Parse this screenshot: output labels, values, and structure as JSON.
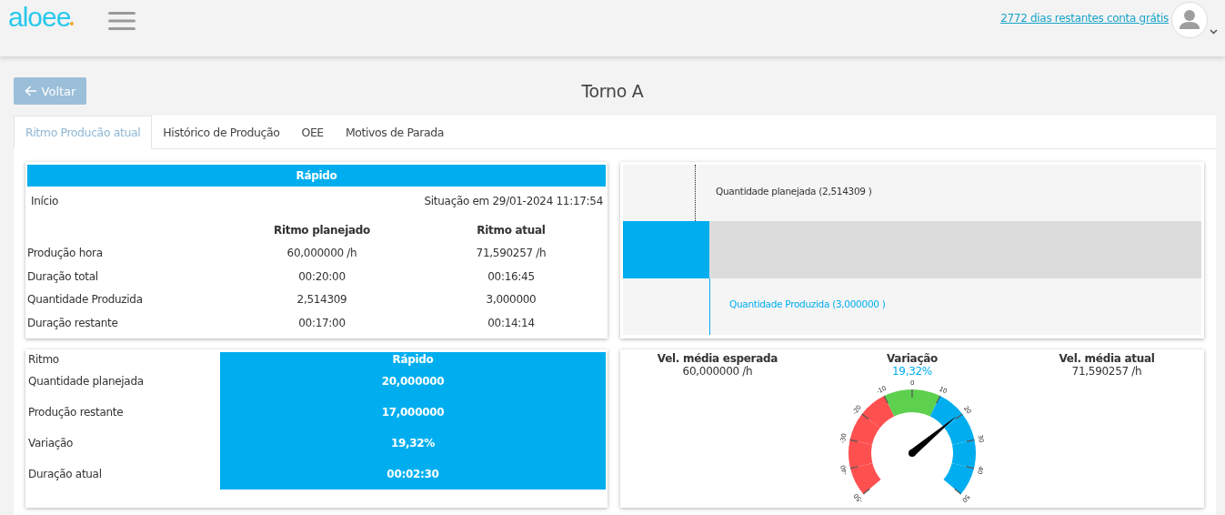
{
  "header": {
    "logo": "aloee",
    "account_link": "2772 dias restantes conta grátis"
  },
  "back_button": "Voltar",
  "page_title": "Torno A",
  "tabs": [
    {
      "label": "Ritmo Producão atual",
      "selected": true
    },
    {
      "label": "Histórico de Produção",
      "selected": false
    },
    {
      "label": "OEE",
      "selected": false
    },
    {
      "label": "Motivos de Parada",
      "selected": false
    }
  ],
  "summary": {
    "status": "Rápido",
    "start_label": "Início",
    "situation": "Situação em 29/01-2024 11:17:54",
    "columns": [
      "Ritmo planejado",
      "Ritmo atual"
    ],
    "rows": [
      {
        "label": "Produção hora",
        "planned": "60,000000 /h",
        "actual": "71,590257 /h"
      },
      {
        "label": "Duração total",
        "planned": "00:20:00",
        "actual": "00:16:45"
      },
      {
        "label": "Quantidade Produzida",
        "planned": "2,514309",
        "actual": "3,000000"
      },
      {
        "label": "Duração restante",
        "planned": "00:17:00",
        "actual": "00:14:14"
      }
    ]
  },
  "progress": {
    "planned": {
      "label": "Quantidade planejada (2,514309 )",
      "level": 0.124
    },
    "produced": {
      "label": "Quantidade Produzida (3,000000 )",
      "level": 0.15
    }
  },
  "rhythm": [
    {
      "kind": "header",
      "label": "Ritmo",
      "value": "Rápido"
    },
    {
      "kind": "row",
      "label": "Quantidade planejada",
      "value": "20,000000"
    },
    {
      "kind": "row",
      "label": "Produção restante",
      "value": "17,000000"
    },
    {
      "kind": "row",
      "label": "Variação",
      "value": "19,32%"
    },
    {
      "kind": "row",
      "label": "Duração atual",
      "value": "00:02:30"
    }
  ],
  "speed": {
    "stats": [
      {
        "label": "Vel. média esperada",
        "value": "60,000000 /h",
        "kind": "plain"
      },
      {
        "label": "Variação",
        "value": "19,32%",
        "kind": "accent"
      },
      {
        "label": "Vel. média atual",
        "value": "71,590257 /h",
        "kind": "plain"
      }
    ],
    "gauge": {
      "ticks": [
        "-50",
        "-40",
        "-30",
        "-20",
        "-10",
        "0",
        "10",
        "20",
        "30",
        "40",
        "50"
      ],
      "segments": [
        {
          "color": "#ff5050"
        },
        {
          "color": "#ff5050"
        },
        {
          "color": "#ff5050"
        },
        {
          "color": "#ff5050"
        },
        {
          "color": "#5dd04e"
        },
        {
          "color": "#5dd04e"
        },
        {
          "color": "#00aeef"
        },
        {
          "color": "#00aeef"
        },
        {
          "color": "#00aeef"
        },
        {
          "color": "#00aeef"
        }
      ]
    }
  }
}
